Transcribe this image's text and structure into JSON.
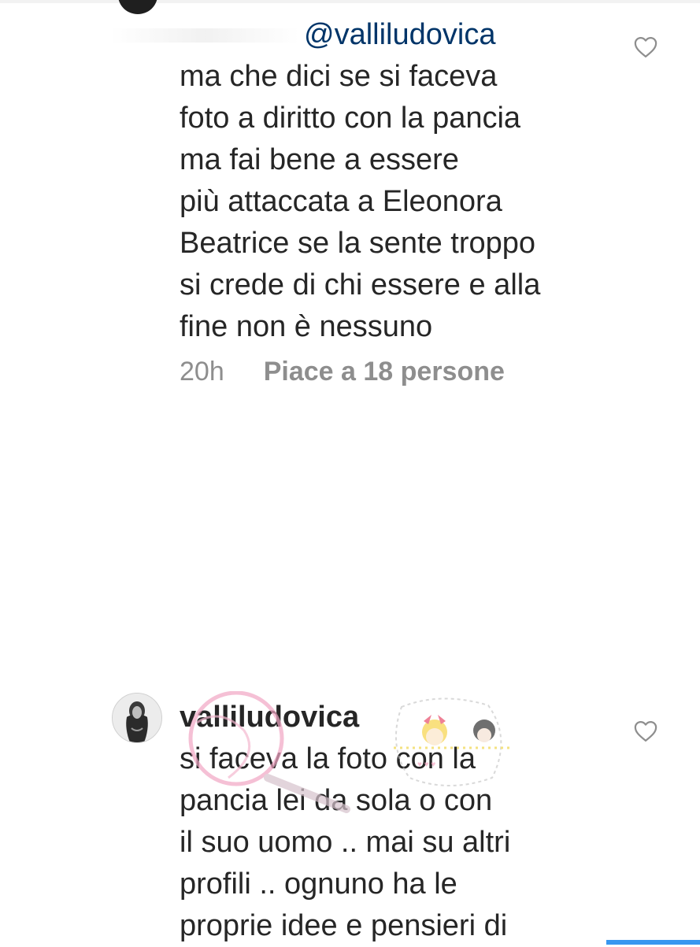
{
  "comments": [
    {
      "mention": "@valliludovica",
      "text": "ma che dici se si faceva\nfoto a diritto con la pancia\nma fai bene a essere\npiù attaccata a Eleonora\nBeatrice se la sente troppo\nsi crede di chi essere e alla\nfine non è nessuno",
      "time": "20h",
      "likes": "Piace a 18 persone",
      "like_icon": "heart-outline-icon"
    },
    {
      "username": "valliludovica",
      "text": "si faceva la foto con la\npancia lei da sola o con\nil suo uomo .. mai su altri\nprofili .. ognuno ha le\nproprie idee e pensieri di",
      "like_icon": "heart-outline-icon"
    }
  ],
  "colors": {
    "text": "#262626",
    "mention": "#003569",
    "meta": "#8e8e8e",
    "accent": "#3897f0"
  }
}
